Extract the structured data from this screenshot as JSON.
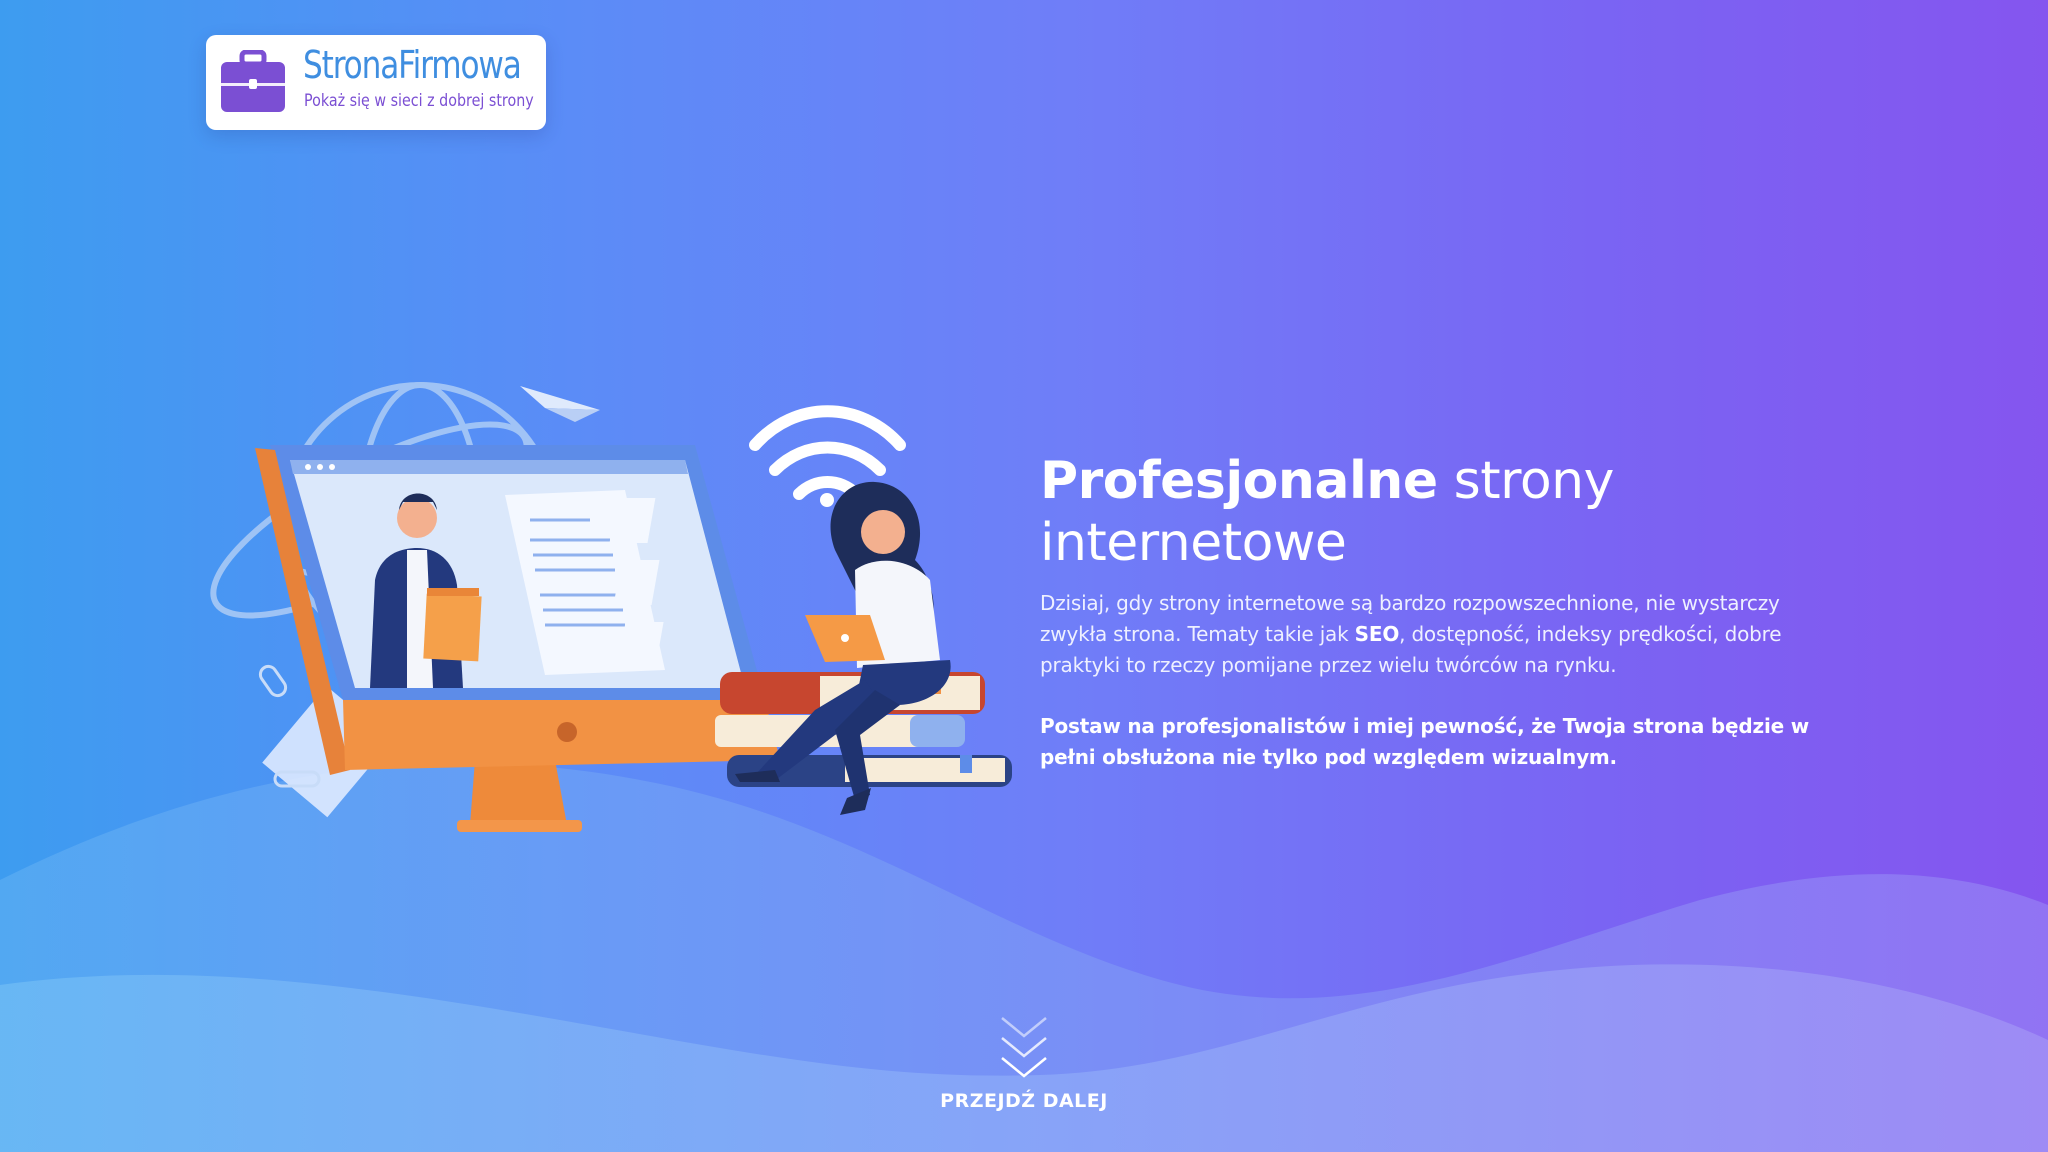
{
  "brand": {
    "name": "StronaFirmowa",
    "tagline": "Pokaż się w sieci z dobrej strony",
    "icon": "briefcase-icon",
    "colors": {
      "name": "#3f8ee0",
      "tagline": "#7b4fd3",
      "icon": "#7b4fd3"
    }
  },
  "hero": {
    "title_bold": "Profesjonalne",
    "title_rest_line1": " strony",
    "title_line2": "internetowe",
    "description": {
      "part1": "Dzisiaj, gdy strony internetowe są bardzo rozpowszechnione, nie wystarczy zwykła strona. Tematy takie jak ",
      "bold": "SEO",
      "part2": ", dostępność, indeksy prędkości, dobre praktyki to rzeczy pomijane przez wielu twórców na rynku."
    },
    "cta_text": "Postaw na profesjonalistów i miej pewność, że Twoja strona będzie w pełni obsłużona nie tylko pod względem wizualnym."
  },
  "scroll": {
    "label": "PRZEJDŹ DALEJ",
    "icon": "chevrons-down-icon"
  },
  "theme": {
    "gradient_start": "#3d9cf0",
    "gradient_end": "#8555ef",
    "text": "#ffffff"
  }
}
